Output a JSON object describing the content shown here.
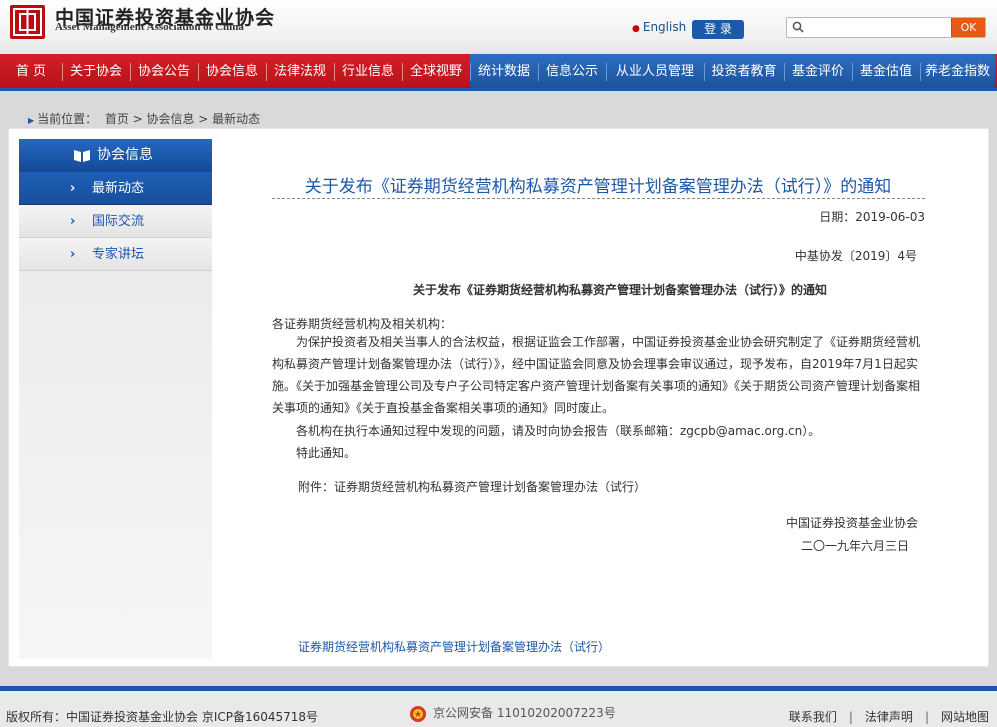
{
  "header": {
    "logo_cn": "中国证券投资基金业协会",
    "logo_en": "Asset Management Association of China",
    "lang_link": "English",
    "login_label": "登 录",
    "search_placeholder": "",
    "search_button": "OK"
  },
  "nav": {
    "items": [
      {
        "label": "首 页",
        "style": "red"
      },
      {
        "label": "关于协会",
        "style": "red"
      },
      {
        "label": "协会公告",
        "style": "red"
      },
      {
        "label": "协会信息",
        "style": "red"
      },
      {
        "label": "法律法规",
        "style": "red"
      },
      {
        "label": "行业信息",
        "style": "red"
      },
      {
        "label": "全球视野",
        "style": "red"
      },
      {
        "label": "统计数据",
        "style": "blue"
      },
      {
        "label": "信息公示",
        "style": "blue"
      },
      {
        "label": "从业人员管理",
        "style": "blue"
      },
      {
        "label": "投资者教育",
        "style": "blue"
      },
      {
        "label": "基金评价",
        "style": "blue"
      },
      {
        "label": "基金估值",
        "style": "blue"
      },
      {
        "label": "养老金指数",
        "style": "blue"
      }
    ]
  },
  "breadcrumb": {
    "label": "当前位置：",
    "path": "首页 > 协会信息 > 最新动态"
  },
  "sidebar": {
    "header": "协会信息",
    "items": [
      {
        "label": "最新动态",
        "active": true
      },
      {
        "label": "国际交流",
        "active": false
      },
      {
        "label": "专家讲坛",
        "active": false
      }
    ]
  },
  "article": {
    "title": "关于发布《证券期货经营机构私募资产管理计划备案管理办法（试行）》的通知",
    "date": "日期：2019-06-03",
    "doc_no": "中基协发〔2019〕4号",
    "inner_title": "关于发布《证券期货经营机构私募资产管理计划备案管理办法（试行）》的通知",
    "salutation": "各证券期货经营机构及相关机构：",
    "paragraph1": "为保护投资者及相关当事人的合法权益，根据证监会工作部署，中国证券投资基金业协会研究制定了《证券期货经营机构私募资产管理计划备案管理办法（试行）》，经中国证监会同意及协会理事会审议通过，现予发布，自2019年7月1日起实施。《关于加强基金管理公司及专户子公司特定客户资产管理计划备案有关事项的通知》《关于期货公司资产管理计划备案相关事项的通知》《关于直投基金备案相关事项的通知》同时废止。",
    "paragraph2": "各机构在执行本通知过程中发现的问题，请及时向协会报告（联系邮箱：zgcpb@amac.org.cn）。",
    "paragraph3": "特此通知。",
    "attachment": "附件：证券期货经营机构私募资产管理计划备案管理办法（试行）",
    "signature_org": "中国证券投资基金业协会",
    "signature_date": "二〇一九年六月三日",
    "attachment_link": "证券期货经营机构私募资产管理计划备案管理办法（试行）"
  },
  "footer": {
    "copyright": "版权所有：中国证券投资基金业协会 京ICP备16045718号",
    "police": "京公网安备 11010202007223号",
    "links": [
      "联系我们",
      "法律声明",
      "网站地图"
    ]
  },
  "colors": {
    "nav_red": "#c8161e",
    "nav_blue": "#1d57a8",
    "link_blue": "#1d57a8",
    "search_button": "#e55a16"
  }
}
